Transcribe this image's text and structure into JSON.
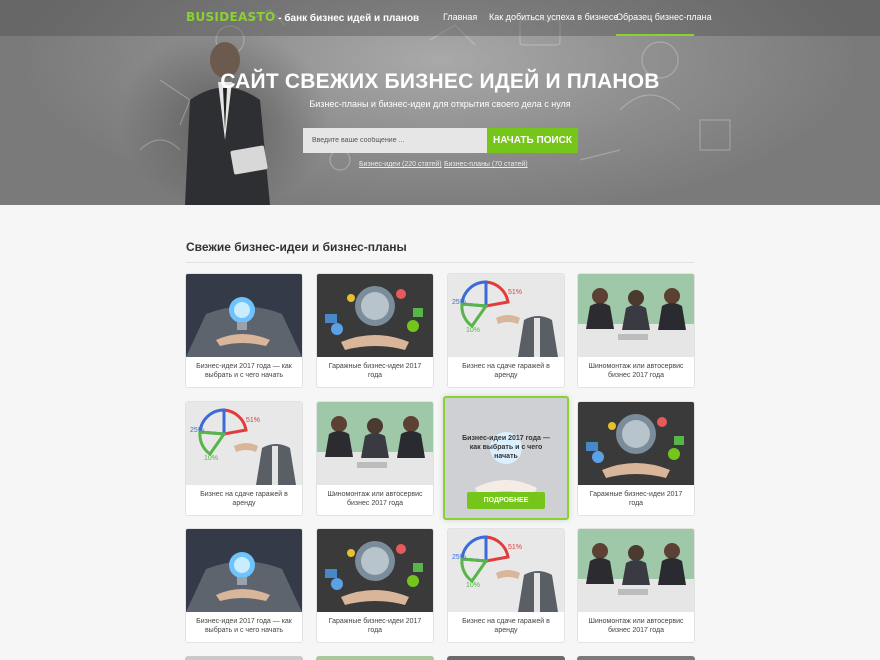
{
  "header": {
    "logo_brand": "BUSIDEASTO",
    "logo_tagline": " - банк бизнес идей и планов",
    "nav": [
      {
        "label": "Главная"
      },
      {
        "label": "Как добиться успеха в бизнесе"
      },
      {
        "label": "Образец бизнес-плана",
        "active": true
      }
    ]
  },
  "hero": {
    "title": "САЙТ СВЕЖИХ БИЗНЕС ИДЕЙ И ПЛАНОВ",
    "subtitle": "Бизнес-планы и бизнес-идеи для открытия своего дела с нуля",
    "search_placeholder": "Введите ваше сообщение ...",
    "search_button": "НАЧАТЬ ПОИСК",
    "links": [
      {
        "label": "Бизнес-идеи (220 статей)"
      },
      {
        "label": "Бизнес-планы (70 статей)"
      }
    ]
  },
  "section": {
    "title": "Свежие бизнес-идеи и бизнес-планы"
  },
  "cards": [
    {
      "caption": "Бизнес-идеи 2017 года — как выбрать и с чего начать",
      "image": "lightbulb-hand"
    },
    {
      "caption": "Гаражные бизнес-идеи 2017 года",
      "image": "globe-hand"
    },
    {
      "caption": "Бизнес на сдаче гаражей в аренду",
      "image": "pie-chart-hand"
    },
    {
      "caption": "Шиномонтаж или автосервис бизнес 2017 года",
      "image": "business-meeting"
    },
    {
      "caption": "Бизнес на сдаче гаражей в аренду",
      "image": "pie-chart-hand"
    },
    {
      "caption": "Шиномонтаж или автосервис бизнес 2017 года",
      "image": "business-meeting"
    },
    {
      "caption": "Гаражные бизнес-идеи 2017 года",
      "image": "globe-hand"
    },
    {
      "caption": "Бизнес-идеи 2017 года — как выбрать и с чего начать",
      "image": "lightbulb-hand"
    },
    {
      "caption": "Гаражные бизнес-идеи 2017 года",
      "image": "globe-hand"
    },
    {
      "caption": "Бизнес на сдаче гаражей в аренду",
      "image": "pie-chart-hand"
    },
    {
      "caption": "Шиномонтаж или автосервис бизнес 2017 года",
      "image": "business-meeting"
    }
  ],
  "active_card": {
    "title": "Бизнес-идеи 2017 года — как выбрать и с чего начать",
    "button": "ПОДРОБНЕЕ"
  },
  "pie_labels": [
    "51%",
    "25%",
    "10%"
  ],
  "colors": {
    "accent": "#76c51b",
    "accent_light": "#8ad132"
  }
}
